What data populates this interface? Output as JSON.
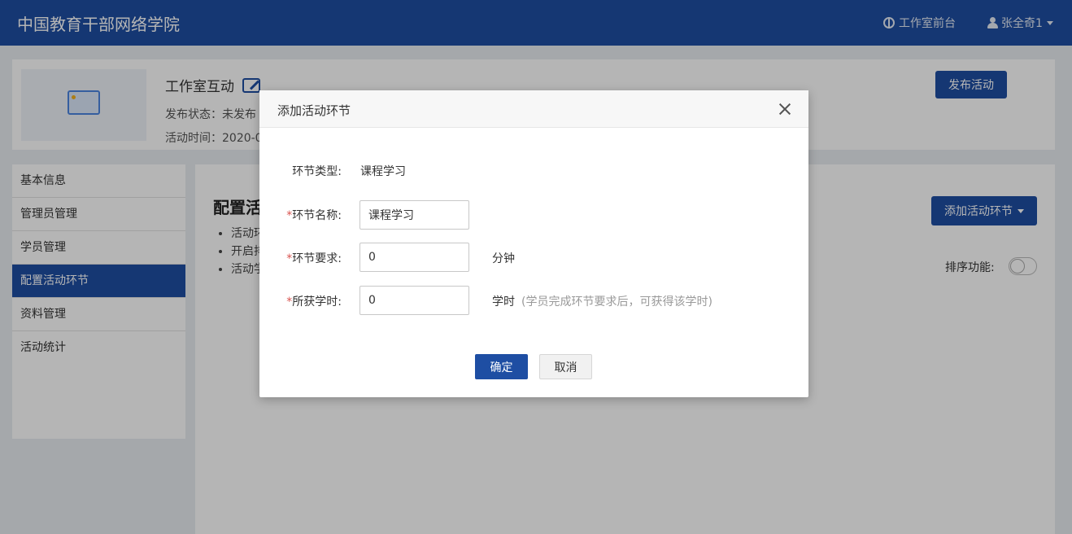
{
  "topbar": {
    "brand": "中国教育干部网络学院",
    "studio_front_label": "工作室前台",
    "user_name": "张全奇1"
  },
  "header_card": {
    "title": "工作室互动",
    "status_label": "发布状态：未发布",
    "time_label": "活动时间：2020-0",
    "publish_button": "发布活动"
  },
  "sidebar": {
    "items": [
      {
        "label": "基本信息"
      },
      {
        "label": "管理员管理"
      },
      {
        "label": "学员管理"
      },
      {
        "label": "配置活动环节"
      },
      {
        "label": "资料管理"
      },
      {
        "label": "活动统计"
      }
    ],
    "active_index": 3
  },
  "main": {
    "title": "配置活",
    "list": [
      "活动环",
      "开启排",
      "活动学"
    ],
    "add_step_button": "添加活动环节",
    "sort_label": "排序功能:",
    "sort_enabled": false
  },
  "modal": {
    "title": "添加活动环节",
    "fields": {
      "type_label": "环节类型:",
      "type_value": "课程学习",
      "name_label": "环节名称:",
      "name_value": "课程学习",
      "requirement_label": "环节要求:",
      "requirement_value": "0",
      "requirement_unit": "分钟",
      "hours_label": "所获学时:",
      "hours_value": "0",
      "hours_unit": "学时",
      "hours_hint": "(学员完成环节要求后，可获得该学时)"
    },
    "required_mark": "*",
    "ok_button": "确定",
    "cancel_button": "取消"
  },
  "colors": {
    "primary": "#1e4ea3",
    "required": "#d9534f"
  }
}
